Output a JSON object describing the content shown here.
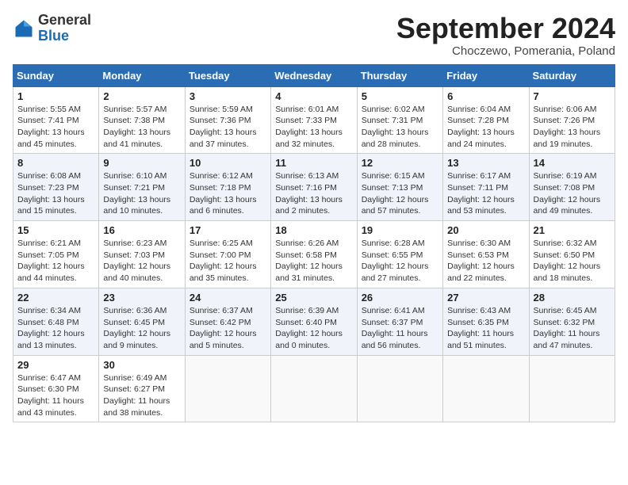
{
  "header": {
    "title": "September 2024",
    "location": "Choczewo, Pomerania, Poland",
    "logo_general": "General",
    "logo_blue": "Blue"
  },
  "calendar": {
    "days_of_week": [
      "Sunday",
      "Monday",
      "Tuesday",
      "Wednesday",
      "Thursday",
      "Friday",
      "Saturday"
    ],
    "weeks": [
      [
        {
          "day": "",
          "info": ""
        },
        {
          "day": "2",
          "info": "Sunrise: 5:57 AM\nSunset: 7:38 PM\nDaylight: 13 hours\nand 41 minutes."
        },
        {
          "day": "3",
          "info": "Sunrise: 5:59 AM\nSunset: 7:36 PM\nDaylight: 13 hours\nand 37 minutes."
        },
        {
          "day": "4",
          "info": "Sunrise: 6:01 AM\nSunset: 7:33 PM\nDaylight: 13 hours\nand 32 minutes."
        },
        {
          "day": "5",
          "info": "Sunrise: 6:02 AM\nSunset: 7:31 PM\nDaylight: 13 hours\nand 28 minutes."
        },
        {
          "day": "6",
          "info": "Sunrise: 6:04 AM\nSunset: 7:28 PM\nDaylight: 13 hours\nand 24 minutes."
        },
        {
          "day": "7",
          "info": "Sunrise: 6:06 AM\nSunset: 7:26 PM\nDaylight: 13 hours\nand 19 minutes."
        }
      ],
      [
        {
          "day": "1",
          "info": "Sunrise: 5:55 AM\nSunset: 7:41 PM\nDaylight: 13 hours\nand 45 minutes."
        },
        {
          "day": "",
          "info": ""
        },
        {
          "day": "",
          "info": ""
        },
        {
          "day": "",
          "info": ""
        },
        {
          "day": "",
          "info": ""
        },
        {
          "day": "",
          "info": ""
        },
        {
          "day": "",
          "info": ""
        }
      ],
      [
        {
          "day": "8",
          "info": "Sunrise: 6:08 AM\nSunset: 7:23 PM\nDaylight: 13 hours\nand 15 minutes."
        },
        {
          "day": "9",
          "info": "Sunrise: 6:10 AM\nSunset: 7:21 PM\nDaylight: 13 hours\nand 10 minutes."
        },
        {
          "day": "10",
          "info": "Sunrise: 6:12 AM\nSunset: 7:18 PM\nDaylight: 13 hours\nand 6 minutes."
        },
        {
          "day": "11",
          "info": "Sunrise: 6:13 AM\nSunset: 7:16 PM\nDaylight: 13 hours\nand 2 minutes."
        },
        {
          "day": "12",
          "info": "Sunrise: 6:15 AM\nSunset: 7:13 PM\nDaylight: 12 hours\nand 57 minutes."
        },
        {
          "day": "13",
          "info": "Sunrise: 6:17 AM\nSunset: 7:11 PM\nDaylight: 12 hours\nand 53 minutes."
        },
        {
          "day": "14",
          "info": "Sunrise: 6:19 AM\nSunset: 7:08 PM\nDaylight: 12 hours\nand 49 minutes."
        }
      ],
      [
        {
          "day": "15",
          "info": "Sunrise: 6:21 AM\nSunset: 7:05 PM\nDaylight: 12 hours\nand 44 minutes."
        },
        {
          "day": "16",
          "info": "Sunrise: 6:23 AM\nSunset: 7:03 PM\nDaylight: 12 hours\nand 40 minutes."
        },
        {
          "day": "17",
          "info": "Sunrise: 6:25 AM\nSunset: 7:00 PM\nDaylight: 12 hours\nand 35 minutes."
        },
        {
          "day": "18",
          "info": "Sunrise: 6:26 AM\nSunset: 6:58 PM\nDaylight: 12 hours\nand 31 minutes."
        },
        {
          "day": "19",
          "info": "Sunrise: 6:28 AM\nSunset: 6:55 PM\nDaylight: 12 hours\nand 27 minutes."
        },
        {
          "day": "20",
          "info": "Sunrise: 6:30 AM\nSunset: 6:53 PM\nDaylight: 12 hours\nand 22 minutes."
        },
        {
          "day": "21",
          "info": "Sunrise: 6:32 AM\nSunset: 6:50 PM\nDaylight: 12 hours\nand 18 minutes."
        }
      ],
      [
        {
          "day": "22",
          "info": "Sunrise: 6:34 AM\nSunset: 6:48 PM\nDaylight: 12 hours\nand 13 minutes."
        },
        {
          "day": "23",
          "info": "Sunrise: 6:36 AM\nSunset: 6:45 PM\nDaylight: 12 hours\nand 9 minutes."
        },
        {
          "day": "24",
          "info": "Sunrise: 6:37 AM\nSunset: 6:42 PM\nDaylight: 12 hours\nand 5 minutes."
        },
        {
          "day": "25",
          "info": "Sunrise: 6:39 AM\nSunset: 6:40 PM\nDaylight: 12 hours\nand 0 minutes."
        },
        {
          "day": "26",
          "info": "Sunrise: 6:41 AM\nSunset: 6:37 PM\nDaylight: 11 hours\nand 56 minutes."
        },
        {
          "day": "27",
          "info": "Sunrise: 6:43 AM\nSunset: 6:35 PM\nDaylight: 11 hours\nand 51 minutes."
        },
        {
          "day": "28",
          "info": "Sunrise: 6:45 AM\nSunset: 6:32 PM\nDaylight: 11 hours\nand 47 minutes."
        }
      ],
      [
        {
          "day": "29",
          "info": "Sunrise: 6:47 AM\nSunset: 6:30 PM\nDaylight: 11 hours\nand 43 minutes."
        },
        {
          "day": "30",
          "info": "Sunrise: 6:49 AM\nSunset: 6:27 PM\nDaylight: 11 hours\nand 38 minutes."
        },
        {
          "day": "",
          "info": ""
        },
        {
          "day": "",
          "info": ""
        },
        {
          "day": "",
          "info": ""
        },
        {
          "day": "",
          "info": ""
        },
        {
          "day": "",
          "info": ""
        }
      ]
    ]
  }
}
